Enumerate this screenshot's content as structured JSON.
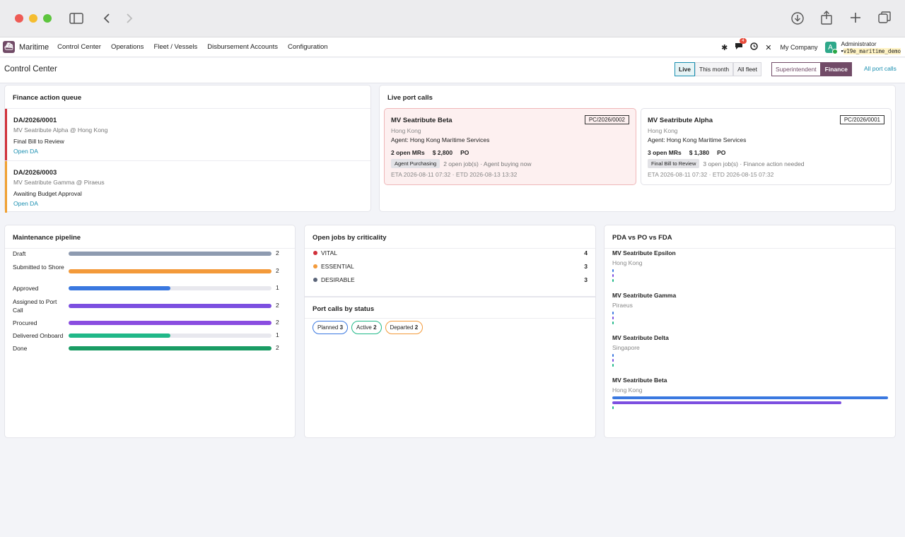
{
  "navbar": {
    "app_name": "Maritime",
    "menu": [
      "Control Center",
      "Operations",
      "Fleet / Vessels",
      "Disbursement Accounts",
      "Configuration"
    ],
    "notification_count": "4",
    "company": "My Company",
    "avatar_letter": "A",
    "user_name": "Administrator",
    "database": "v19e_maritime_demo"
  },
  "subbar": {
    "title": "Control Center",
    "filters": [
      "Live",
      "This month",
      "All fleet"
    ],
    "roles": [
      "Superintendent",
      "Finance"
    ],
    "link": "All port calls"
  },
  "finance": {
    "title": "Finance action queue",
    "items": [
      {
        "id": "DA/2026/0001",
        "vessel": "MV Seatribute Alpha @ Hong Kong",
        "status": "Final Bill to Review",
        "link": "Open DA",
        "color": "#d0303a"
      },
      {
        "id": "DA/2026/0003",
        "vessel": "MV Seatribute Gamma @ Piraeus",
        "status": "Awaiting Budget Approval",
        "link": "Open DA",
        "color": "#f0a030"
      }
    ]
  },
  "portcalls": {
    "title": "Live port calls",
    "items": [
      {
        "name": "MV Seatribute Beta",
        "ref": "PC/2026/0002",
        "port": "Hong Kong",
        "agent": "Agent: Hong Kong Maritime Services",
        "mrs": "2 open MRs",
        "amount": "$ 2,800",
        "po": "PO",
        "tag": "Agent Purchasing",
        "detail": "2 open job(s) · Agent buying now",
        "eta": "ETA 2026-08-11 07:32 · ETD 2026-08-13 13:32"
      },
      {
        "name": "MV Seatribute Alpha",
        "ref": "PC/2026/0001",
        "port": "Hong Kong",
        "agent": "Agent: Hong Kong Maritime Services",
        "mrs": "3 open MRs",
        "amount": "$ 1,380",
        "po": "PO",
        "tag": "Final Bill to Review",
        "detail": "3 open job(s) · Finance action needed",
        "eta": "ETA 2026-08-11 07:32 · ETD 2026-08-15 07:32"
      }
    ]
  },
  "maintenance": {
    "title": "Maintenance pipeline",
    "max": 2,
    "rows": [
      {
        "label": "Draft",
        "value": 2,
        "color": "#8e9bb0"
      },
      {
        "label": "Submitted to Shore",
        "value": 2,
        "color": "#f39a3a"
      },
      {
        "label": "Approved",
        "value": 1,
        "color": "#3a78e0"
      },
      {
        "label": "Assigned to Port Call",
        "value": 2,
        "color": "#7c4fe0"
      },
      {
        "label": "Procured",
        "value": 2,
        "color": "#8a4de0"
      },
      {
        "label": "Delivered Onboard",
        "value": 1,
        "color": "#20b888"
      },
      {
        "label": "Done",
        "value": 2,
        "color": "#1a9c64"
      }
    ]
  },
  "criticality": {
    "title": "Open jobs by criticality",
    "rows": [
      {
        "label": "VITAL",
        "value": "4",
        "color": "#d0303a"
      },
      {
        "label": "ESSENTIAL",
        "value": "3",
        "color": "#f39a3a"
      },
      {
        "label": "DESIRABLE",
        "value": "3",
        "color": "#5a6478"
      }
    ]
  },
  "status": {
    "title": "Port calls by status",
    "pills": [
      {
        "label": "Planned",
        "count": "3",
        "color": "#3a78e0"
      },
      {
        "label": "Active",
        "count": "2",
        "color": "#20b888"
      },
      {
        "label": "Departed",
        "count": "2",
        "color": "#f39a3a"
      }
    ]
  },
  "pda": {
    "title": "PDA vs PO vs FDA",
    "max": 1,
    "vessels": [
      {
        "name": "MV Seatribute Epsilon",
        "port": "Hong Kong",
        "pda": 0,
        "po": 0,
        "fda": 0
      },
      {
        "name": "MV Seatribute Gamma",
        "port": "Piraeus",
        "pda": 0,
        "po": 0,
        "fda": 0
      },
      {
        "name": "MV Seatribute Delta",
        "port": "Singapore",
        "pda": 0,
        "po": 0,
        "fda": 0
      },
      {
        "name": "MV Seatribute Beta",
        "port": "Hong Kong",
        "pda": 1,
        "po": 0.83,
        "fda": 0
      }
    ],
    "colors": {
      "pda": "#3a78e0",
      "po": "#7c4fe0",
      "fda": "#20b888"
    }
  }
}
